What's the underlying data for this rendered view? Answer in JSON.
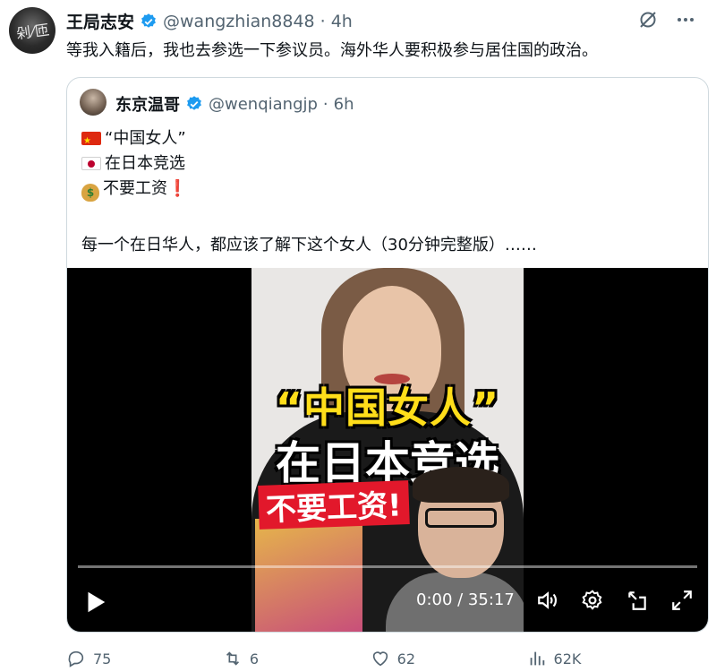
{
  "tweet": {
    "author_name": "王局志安",
    "handle": "@wangzhian8848",
    "separator": "·",
    "time": "4h",
    "text": "等我入籍后，我也去参选一下参议员。海外华人要积极参与居住国的政治。"
  },
  "quote": {
    "author_name": "东京温哥",
    "handle": "@wenqiangjp",
    "separator": "·",
    "time": "6h",
    "line1": "“中国女人”",
    "line2": "在日本竞选",
    "line3": "不要工资",
    "line3_mark": "❗",
    "description": "每一个在日华人，都应该了解下这个女人（30分钟完整版）……",
    "video": {
      "overlay_line1": "“中国女人”",
      "overlay_line2": "在日本竞选",
      "overlay_line3": "不要工资!",
      "timecode": "0:00 / 35:17",
      "progress": 0
    }
  },
  "actions": {
    "replies": "75",
    "retweets": "6",
    "likes": "62",
    "views": "62K"
  },
  "icons": {
    "verified": "verified-badge-icon",
    "grok": "grok-icon",
    "more": "more-icon",
    "reply": "reply-icon",
    "retweet": "retweet-icon",
    "like": "like-icon",
    "views": "views-icon",
    "bookmark": "bookmark-icon"
  },
  "colors": {
    "verified_blue": "#1d9bf0",
    "muted_gray": "#536471",
    "overlay_yellow": "#ffde1a",
    "overlay_red": "#e2182b"
  }
}
